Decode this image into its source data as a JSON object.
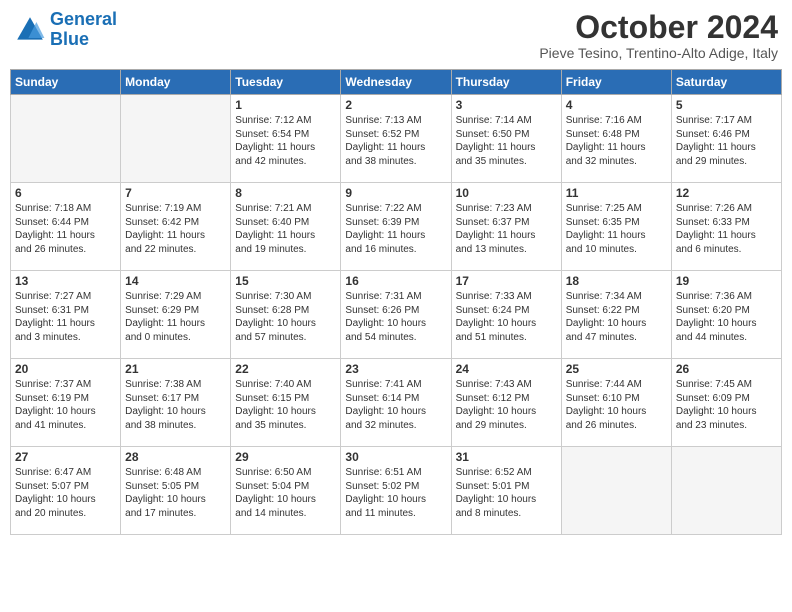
{
  "logo": {
    "name_general": "General",
    "name_blue": "Blue"
  },
  "header": {
    "month": "October 2024",
    "subtitle": "Pieve Tesino, Trentino-Alto Adige, Italy"
  },
  "weekdays": [
    "Sunday",
    "Monday",
    "Tuesday",
    "Wednesday",
    "Thursday",
    "Friday",
    "Saturday"
  ],
  "weeks": [
    [
      {
        "day": "",
        "empty": true
      },
      {
        "day": "",
        "empty": true
      },
      {
        "day": "1",
        "lines": [
          "Sunrise: 7:12 AM",
          "Sunset: 6:54 PM",
          "Daylight: 11 hours",
          "and 42 minutes."
        ]
      },
      {
        "day": "2",
        "lines": [
          "Sunrise: 7:13 AM",
          "Sunset: 6:52 PM",
          "Daylight: 11 hours",
          "and 38 minutes."
        ]
      },
      {
        "day": "3",
        "lines": [
          "Sunrise: 7:14 AM",
          "Sunset: 6:50 PM",
          "Daylight: 11 hours",
          "and 35 minutes."
        ]
      },
      {
        "day": "4",
        "lines": [
          "Sunrise: 7:16 AM",
          "Sunset: 6:48 PM",
          "Daylight: 11 hours",
          "and 32 minutes."
        ]
      },
      {
        "day": "5",
        "lines": [
          "Sunrise: 7:17 AM",
          "Sunset: 6:46 PM",
          "Daylight: 11 hours",
          "and 29 minutes."
        ]
      }
    ],
    [
      {
        "day": "6",
        "lines": [
          "Sunrise: 7:18 AM",
          "Sunset: 6:44 PM",
          "Daylight: 11 hours",
          "and 26 minutes."
        ]
      },
      {
        "day": "7",
        "lines": [
          "Sunrise: 7:19 AM",
          "Sunset: 6:42 PM",
          "Daylight: 11 hours",
          "and 22 minutes."
        ]
      },
      {
        "day": "8",
        "lines": [
          "Sunrise: 7:21 AM",
          "Sunset: 6:40 PM",
          "Daylight: 11 hours",
          "and 19 minutes."
        ]
      },
      {
        "day": "9",
        "lines": [
          "Sunrise: 7:22 AM",
          "Sunset: 6:39 PM",
          "Daylight: 11 hours",
          "and 16 minutes."
        ]
      },
      {
        "day": "10",
        "lines": [
          "Sunrise: 7:23 AM",
          "Sunset: 6:37 PM",
          "Daylight: 11 hours",
          "and 13 minutes."
        ]
      },
      {
        "day": "11",
        "lines": [
          "Sunrise: 7:25 AM",
          "Sunset: 6:35 PM",
          "Daylight: 11 hours",
          "and 10 minutes."
        ]
      },
      {
        "day": "12",
        "lines": [
          "Sunrise: 7:26 AM",
          "Sunset: 6:33 PM",
          "Daylight: 11 hours",
          "and 6 minutes."
        ]
      }
    ],
    [
      {
        "day": "13",
        "lines": [
          "Sunrise: 7:27 AM",
          "Sunset: 6:31 PM",
          "Daylight: 11 hours",
          "and 3 minutes."
        ]
      },
      {
        "day": "14",
        "lines": [
          "Sunrise: 7:29 AM",
          "Sunset: 6:29 PM",
          "Daylight: 11 hours",
          "and 0 minutes."
        ]
      },
      {
        "day": "15",
        "lines": [
          "Sunrise: 7:30 AM",
          "Sunset: 6:28 PM",
          "Daylight: 10 hours",
          "and 57 minutes."
        ]
      },
      {
        "day": "16",
        "lines": [
          "Sunrise: 7:31 AM",
          "Sunset: 6:26 PM",
          "Daylight: 10 hours",
          "and 54 minutes."
        ]
      },
      {
        "day": "17",
        "lines": [
          "Sunrise: 7:33 AM",
          "Sunset: 6:24 PM",
          "Daylight: 10 hours",
          "and 51 minutes."
        ]
      },
      {
        "day": "18",
        "lines": [
          "Sunrise: 7:34 AM",
          "Sunset: 6:22 PM",
          "Daylight: 10 hours",
          "and 47 minutes."
        ]
      },
      {
        "day": "19",
        "lines": [
          "Sunrise: 7:36 AM",
          "Sunset: 6:20 PM",
          "Daylight: 10 hours",
          "and 44 minutes."
        ]
      }
    ],
    [
      {
        "day": "20",
        "lines": [
          "Sunrise: 7:37 AM",
          "Sunset: 6:19 PM",
          "Daylight: 10 hours",
          "and 41 minutes."
        ]
      },
      {
        "day": "21",
        "lines": [
          "Sunrise: 7:38 AM",
          "Sunset: 6:17 PM",
          "Daylight: 10 hours",
          "and 38 minutes."
        ]
      },
      {
        "day": "22",
        "lines": [
          "Sunrise: 7:40 AM",
          "Sunset: 6:15 PM",
          "Daylight: 10 hours",
          "and 35 minutes."
        ]
      },
      {
        "day": "23",
        "lines": [
          "Sunrise: 7:41 AM",
          "Sunset: 6:14 PM",
          "Daylight: 10 hours",
          "and 32 minutes."
        ]
      },
      {
        "day": "24",
        "lines": [
          "Sunrise: 7:43 AM",
          "Sunset: 6:12 PM",
          "Daylight: 10 hours",
          "and 29 minutes."
        ]
      },
      {
        "day": "25",
        "lines": [
          "Sunrise: 7:44 AM",
          "Sunset: 6:10 PM",
          "Daylight: 10 hours",
          "and 26 minutes."
        ]
      },
      {
        "day": "26",
        "lines": [
          "Sunrise: 7:45 AM",
          "Sunset: 6:09 PM",
          "Daylight: 10 hours",
          "and 23 minutes."
        ]
      }
    ],
    [
      {
        "day": "27",
        "lines": [
          "Sunrise: 6:47 AM",
          "Sunset: 5:07 PM",
          "Daylight: 10 hours",
          "and 20 minutes."
        ]
      },
      {
        "day": "28",
        "lines": [
          "Sunrise: 6:48 AM",
          "Sunset: 5:05 PM",
          "Daylight: 10 hours",
          "and 17 minutes."
        ]
      },
      {
        "day": "29",
        "lines": [
          "Sunrise: 6:50 AM",
          "Sunset: 5:04 PM",
          "Daylight: 10 hours",
          "and 14 minutes."
        ]
      },
      {
        "day": "30",
        "lines": [
          "Sunrise: 6:51 AM",
          "Sunset: 5:02 PM",
          "Daylight: 10 hours",
          "and 11 minutes."
        ]
      },
      {
        "day": "31",
        "lines": [
          "Sunrise: 6:52 AM",
          "Sunset: 5:01 PM",
          "Daylight: 10 hours",
          "and 8 minutes."
        ]
      },
      {
        "day": "",
        "empty": true
      },
      {
        "day": "",
        "empty": true
      }
    ]
  ]
}
